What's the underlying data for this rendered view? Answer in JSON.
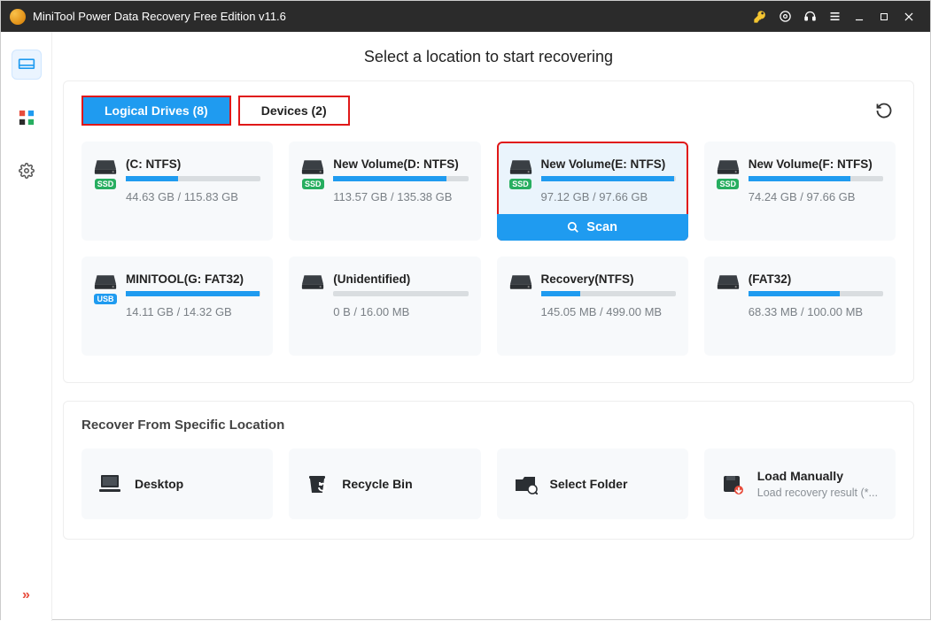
{
  "window": {
    "title": "MiniTool Power Data Recovery Free Edition v11.6"
  },
  "heading": "Select a location to start recovering",
  "tabs": {
    "logical": "Logical Drives (8)",
    "devices": "Devices (2)"
  },
  "scan_label": "Scan",
  "drives": [
    {
      "name": "(C: NTFS)",
      "size": "44.63 GB / 115.83 GB",
      "fill": 39,
      "badge": "SSD",
      "badgeClass": ""
    },
    {
      "name": "New Volume(D: NTFS)",
      "size": "113.57 GB / 135.38 GB",
      "fill": 84,
      "badge": "SSD",
      "badgeClass": ""
    },
    {
      "name": "New Volume(E: NTFS)",
      "size": "97.12 GB / 97.66 GB",
      "fill": 99,
      "badge": "SSD",
      "badgeClass": "",
      "selected": true
    },
    {
      "name": "New Volume(F: NTFS)",
      "size": "74.24 GB / 97.66 GB",
      "fill": 76,
      "badge": "SSD",
      "badgeClass": ""
    },
    {
      "name": "MINITOOL(G: FAT32)",
      "size": "14.11 GB / 14.32 GB",
      "fill": 99,
      "badge": "USB",
      "badgeClass": "usb"
    },
    {
      "name": "(Unidentified)",
      "size": "0 B / 16.00 MB",
      "fill": 0,
      "badge": "",
      "badgeClass": ""
    },
    {
      "name": "Recovery(NTFS)",
      "size": "145.05 MB / 499.00 MB",
      "fill": 29,
      "badge": "",
      "badgeClass": ""
    },
    {
      "name": "(FAT32)",
      "size": "68.33 MB / 100.00 MB",
      "fill": 68,
      "badge": "",
      "badgeClass": ""
    }
  ],
  "specific": {
    "heading": "Recover From Specific Location",
    "items": [
      {
        "title": "Desktop",
        "sub": ""
      },
      {
        "title": "Recycle Bin",
        "sub": ""
      },
      {
        "title": "Select Folder",
        "sub": ""
      },
      {
        "title": "Load Manually",
        "sub": "Load recovery result (*..."
      }
    ]
  }
}
